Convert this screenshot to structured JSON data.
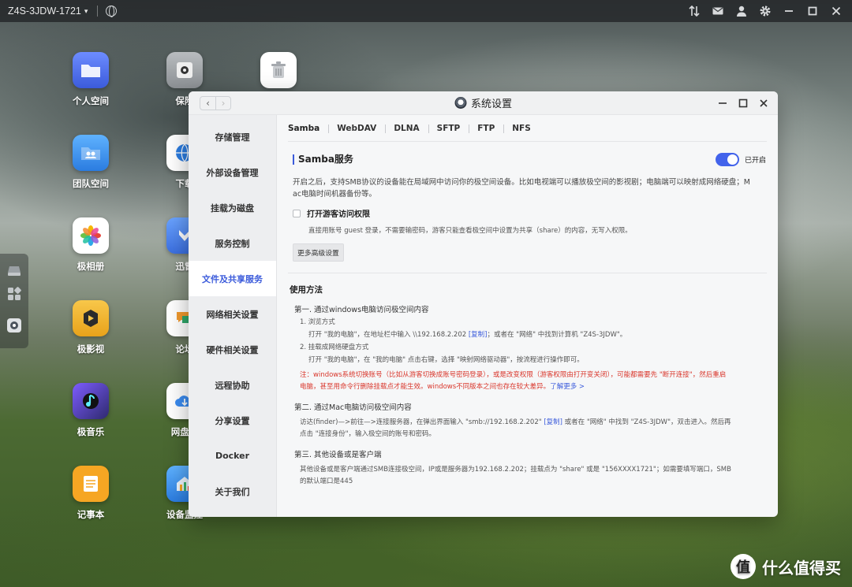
{
  "topbar": {
    "host": "Z4S-3JDW-1721",
    "icons": [
      "globe-icon",
      "sort-icon",
      "mail-icon",
      "user-icon",
      "gear-icon",
      "minimize-icon",
      "maximize-icon",
      "close-icon"
    ]
  },
  "desktop": {
    "col1": [
      {
        "label": "个人空间",
        "icon": "folder-icon"
      },
      {
        "label": "团队空间",
        "icon": "team-folder-icon"
      },
      {
        "label": "极相册",
        "icon": "photos-icon"
      },
      {
        "label": "极影视",
        "icon": "video-icon"
      },
      {
        "label": "极音乐",
        "icon": "music-icon"
      },
      {
        "label": "记事本",
        "icon": "notepad-icon"
      }
    ],
    "col2": [
      {
        "label": "保险",
        "icon": "safe-icon"
      },
      {
        "label": "下载",
        "icon": "download-globe-icon"
      },
      {
        "label": "迅雷",
        "icon": "thunder-icon"
      },
      {
        "label": "论坛",
        "icon": "forum-icon"
      },
      {
        "label": "网盘备",
        "icon": "cloud-backup-icon"
      },
      {
        "label": "设备监控",
        "icon": "monitor-icon"
      }
    ],
    "trash": {
      "label": "",
      "icon": "trash-icon"
    }
  },
  "window": {
    "title": "系统设置",
    "sidebar": [
      {
        "label": "存储管理",
        "active": false
      },
      {
        "label": "外部设备管理",
        "active": false
      },
      {
        "label": "挂载为磁盘",
        "active": false
      },
      {
        "label": "服务控制",
        "active": false
      },
      {
        "label": "文件及共享服务",
        "active": true
      },
      {
        "label": "网络相关设置",
        "active": false
      },
      {
        "label": "硬件相关设置",
        "active": false
      },
      {
        "label": "远程协助",
        "active": false
      },
      {
        "label": "分享设置",
        "active": false
      },
      {
        "label": "Docker",
        "active": false
      },
      {
        "label": "关于我们",
        "active": false
      }
    ],
    "tabs": [
      "Samba",
      "WebDAV",
      "DLNA",
      "SFTP",
      "FTP",
      "NFS"
    ],
    "active_tab": "Samba",
    "samba": {
      "title": "Samba服务",
      "toggle_label": "已开启",
      "enabled": true,
      "desc_line1": "开启之后，支持SMB协议的设备能在局域网中访问你的极空间设备。比如电视端可以播放极空间的影视剧；电脑端可以映射成网络硬盘；M",
      "desc_line2": "ac电脑时间机器备份等。",
      "guest_label": "打开游客访问权限",
      "guest_desc": "直接用账号 guest 登录，不需要输密码，游客只能查看极空间中设置为共享（share）的内容，无写入权限。",
      "advanced_button": "更多高级设置"
    },
    "usage": {
      "title": "使用方法",
      "windows_title": "第一. 通过windows电脑访问极空间内容",
      "win_1": "1. 浏览方式",
      "win_1_text_a": "打开 \"我的电脑\"，在地址栏中输入 \\\\192.168.2.202 ",
      "copy_label": "[复制]",
      "win_1_text_b": "；或者在 \"网络\" 中找到计算机 \"Z4S-3JDW\"。",
      "win_2": "2. 挂载成网络硬盘方式",
      "win_2_text": "打开 \"我的电脑\"，在 \"我的电脑\" 点击右键，选择 \"映射网络驱动器\"，按流程进行操作即可。",
      "warn_line1": "注：windows系统切换账号（比如从游客切换成账号密码登录），或是改变权限（游客权限由打开变关闭），可能都需要先 \"断开连接\"，然后重启",
      "warn_line2": "电脑，甚至用命令行删除挂载点才能生效。windows不同版本之间也存在较大差异。",
      "learn_more": "了解更多 >",
      "mac_title": "第二. 通过Mac电脑访问极空间内容",
      "mac_text_a": "访达(finder)—>前往—>连接服务器，在弹出界面输入 \"smb://192.168.2.202\" ",
      "mac_text_b": " 或者在 \"网络\" 中找到 \"Z4S-3JDW\"，双击进入。然后再",
      "mac_text_c": "点击 \"连接身份\"，输入极空间的账号和密码。",
      "other_title": "第三. 其他设备或是客户端",
      "other_line1": "其他设备或是客户端通过SMB连接极空间，IP或是服务器为192.168.2.202；挂载点为 \"share\" 或是 \"156XXXX1721\"；如需要填写端口，SMB",
      "other_line2": "的默认端口是445"
    }
  },
  "watermark": {
    "logo": "值",
    "text": "什么值得买"
  },
  "colors": {
    "accent": "#3b5bdb",
    "warn": "#d9362b"
  }
}
